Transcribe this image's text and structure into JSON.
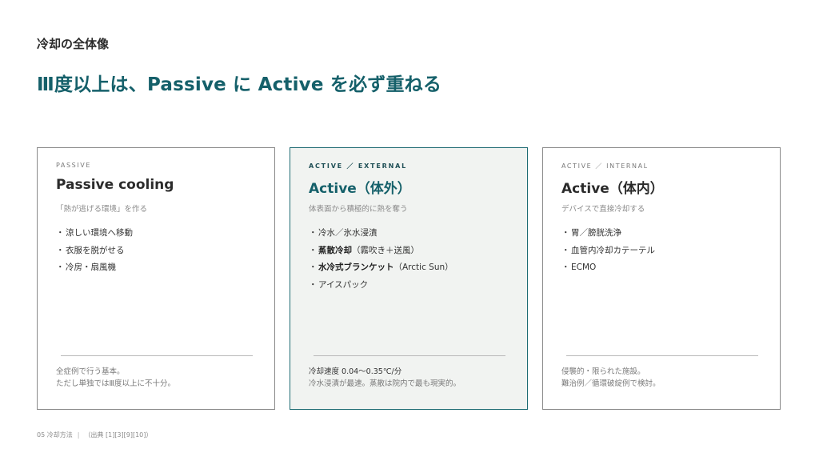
{
  "section_title": "冷却の全体像",
  "headline": "Ⅲ度以上は、Passive に Active を必ず重ねる",
  "cards": [
    {
      "kicker": "PASSIVE",
      "title": "Passive cooling",
      "subtitle": "「熱が逃げる環境」を作る",
      "items": [
        {
          "bold": "",
          "text": "涼しい環境へ移動"
        },
        {
          "bold": "",
          "text": "衣服を脱がせる"
        },
        {
          "bold": "",
          "text": "冷房・扇風機"
        }
      ],
      "note_line1": "全症例で行う基本。",
      "note_line2": "ただし単独ではⅢ度以上に不十分。"
    },
    {
      "kicker": "ACTIVE ／ EXTERNAL",
      "title": "Active（体外）",
      "subtitle": "体表面から積極的に熱を奪う",
      "items": [
        {
          "bold": "",
          "text": "冷水／氷水浸漬"
        },
        {
          "bold": "蒸散冷却",
          "text": "（霧吹き＋送風）"
        },
        {
          "bold": "水冷式ブランケット",
          "text": "（Arctic Sun）"
        },
        {
          "bold": "",
          "text": "アイスパック"
        }
      ],
      "note_line1": "冷却速度 0.04〜0.35℃/分",
      "note_line2": "冷水浸漬が最速。蒸散は院内で最も現実的。"
    },
    {
      "kicker": "ACTIVE ／ INTERNAL",
      "title": "Active（体内）",
      "subtitle": "デバイスで直接冷却する",
      "items": [
        {
          "bold": "",
          "text": "胃／膀胱洗浄"
        },
        {
          "bold": "",
          "text": "血管内冷却カテーテル"
        },
        {
          "bold": "",
          "text": "ECMO"
        }
      ],
      "note_line1": "侵襲的・限られた施設。",
      "note_line2": "難治例／循環破綻例で検討。"
    }
  ],
  "footer": {
    "page_label": "05 冷却方法",
    "source": "（出典 [1][3][9][10]）"
  }
}
